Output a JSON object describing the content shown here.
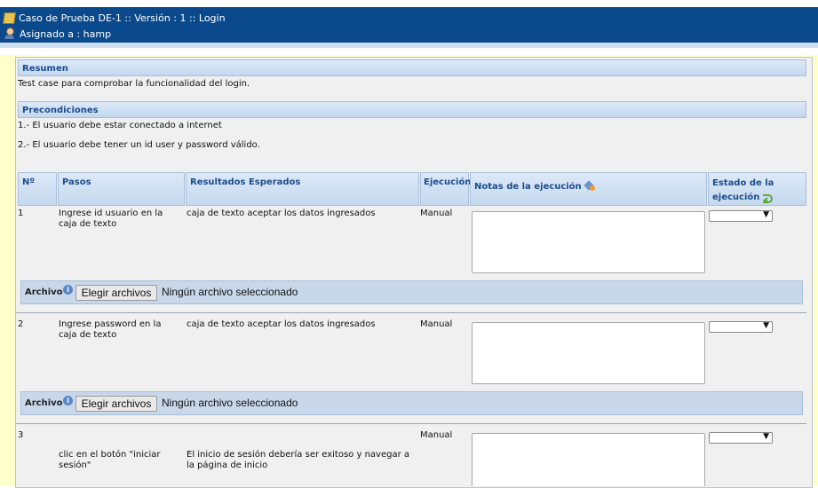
{
  "header": {
    "title": "Caso de Prueba DE-1 :: Versión : 1 :: Login",
    "assigned": "Asignado a : hamp"
  },
  "summary": {
    "label": "Resumen",
    "text": "Test case para  comprobar la funcionalidad del login."
  },
  "preconditions": {
    "label": "Precondiciones",
    "items": [
      "1.- El usuario debe estar conectado a internet",
      "2.- El usuario debe tener un id user y password válido."
    ]
  },
  "table": {
    "headers": {
      "num": "Nº",
      "steps": "Pasos",
      "expected": "Resultados Esperados",
      "execution": "Ejecución",
      "notes": "Notas de la ejecución",
      "status_line1": "Estado de la",
      "status_line2": "ejecución"
    },
    "rows": [
      {
        "num": "1",
        "step": "Ingrese id usuario en la caja de texto",
        "expected": "caja de texto aceptar los datos ingresados",
        "execution": "Manual",
        "status": ""
      },
      {
        "num": "2",
        "step": "Ingrese password en la caja de texto",
        "expected": "caja de texto aceptar los datos ingresados",
        "execution": "Manual",
        "status": ""
      },
      {
        "num": "3",
        "step": "clic en el botón \"iniciar sesión\"",
        "expected": "El inicio de sesión debería ser exitoso y navegar a la página de inicio",
        "execution": "Manual",
        "status": ""
      }
    ]
  },
  "attachment": {
    "label": "Archivo",
    "button": "Elegir archivos",
    "status": "Ningún archivo seleccionado"
  },
  "icons": {
    "header_title": "pencil-icon",
    "header_assigned": "user-icon",
    "notes_header": "add-note-icon",
    "status_header": "arrow-icon",
    "attachment": "info-icon"
  },
  "colors": {
    "header_bg": "#0a4a8c",
    "page_bg": "#ffffcc",
    "panel_bg": "#f0f0f0",
    "section_text": "#1c4c8c"
  }
}
